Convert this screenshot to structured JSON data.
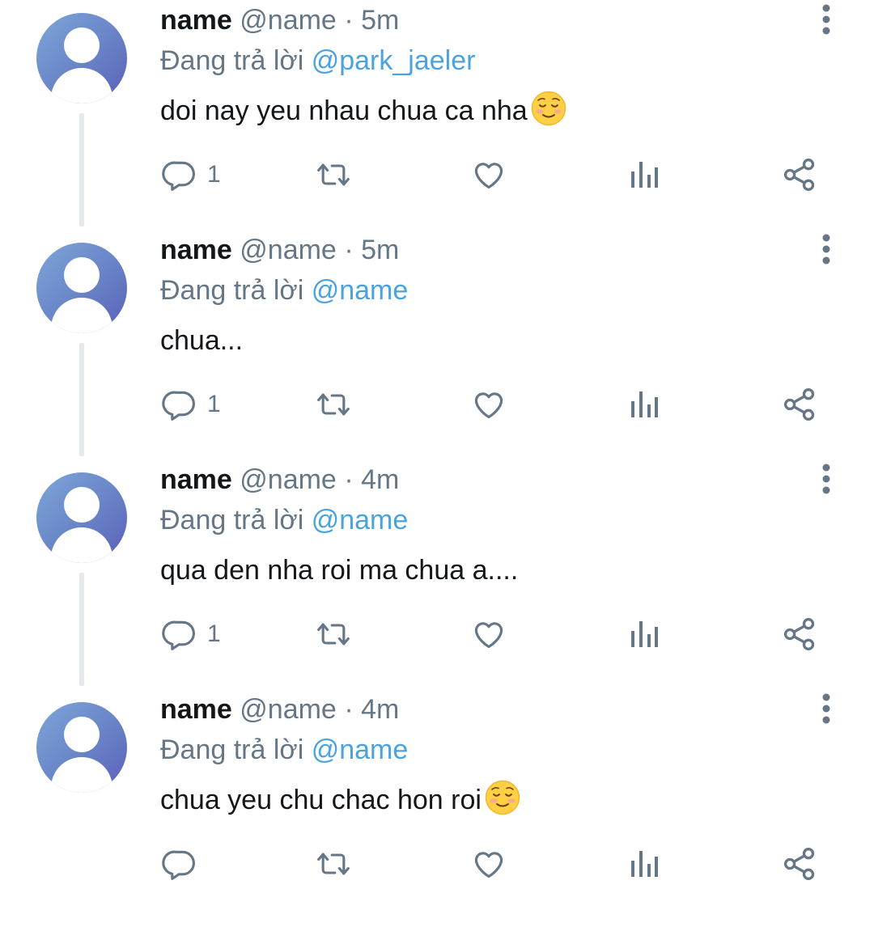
{
  "colors": {
    "accent": "#4aa3df",
    "muted": "#657786",
    "text": "#14171a"
  },
  "icons": [
    "avatar-placeholder",
    "more-vertical-icon",
    "reply-icon",
    "retweet-icon",
    "like-icon",
    "analytics-icon",
    "share-icon",
    "smiling-face-emoji"
  ],
  "tweets": [
    {
      "name": "name",
      "handle": "@name",
      "sep": "·",
      "time": "5m",
      "reply_prefix": "Đang trả lời",
      "reply_to": "@park_jaeler",
      "text": "doi nay yeu nhau chua ca nha",
      "has_emoji": true,
      "reply_count": "1"
    },
    {
      "name": "name",
      "handle": "@name",
      "sep": "·",
      "time": "5m",
      "reply_prefix": "Đang trả lời",
      "reply_to": "@name",
      "text": "chua...",
      "has_emoji": false,
      "reply_count": "1"
    },
    {
      "name": "name",
      "handle": "@name",
      "sep": "·",
      "time": "4m",
      "reply_prefix": "Đang trả lời",
      "reply_to": "@name",
      "text": "qua den nha roi ma chua a....",
      "has_emoji": false,
      "reply_count": "1"
    },
    {
      "name": "name",
      "handle": "@name",
      "sep": "·",
      "time": "4m",
      "reply_prefix": "Đang trả lời",
      "reply_to": "@name",
      "text": "chua yeu chu chac hon roi",
      "has_emoji": true,
      "reply_count": ""
    }
  ]
}
